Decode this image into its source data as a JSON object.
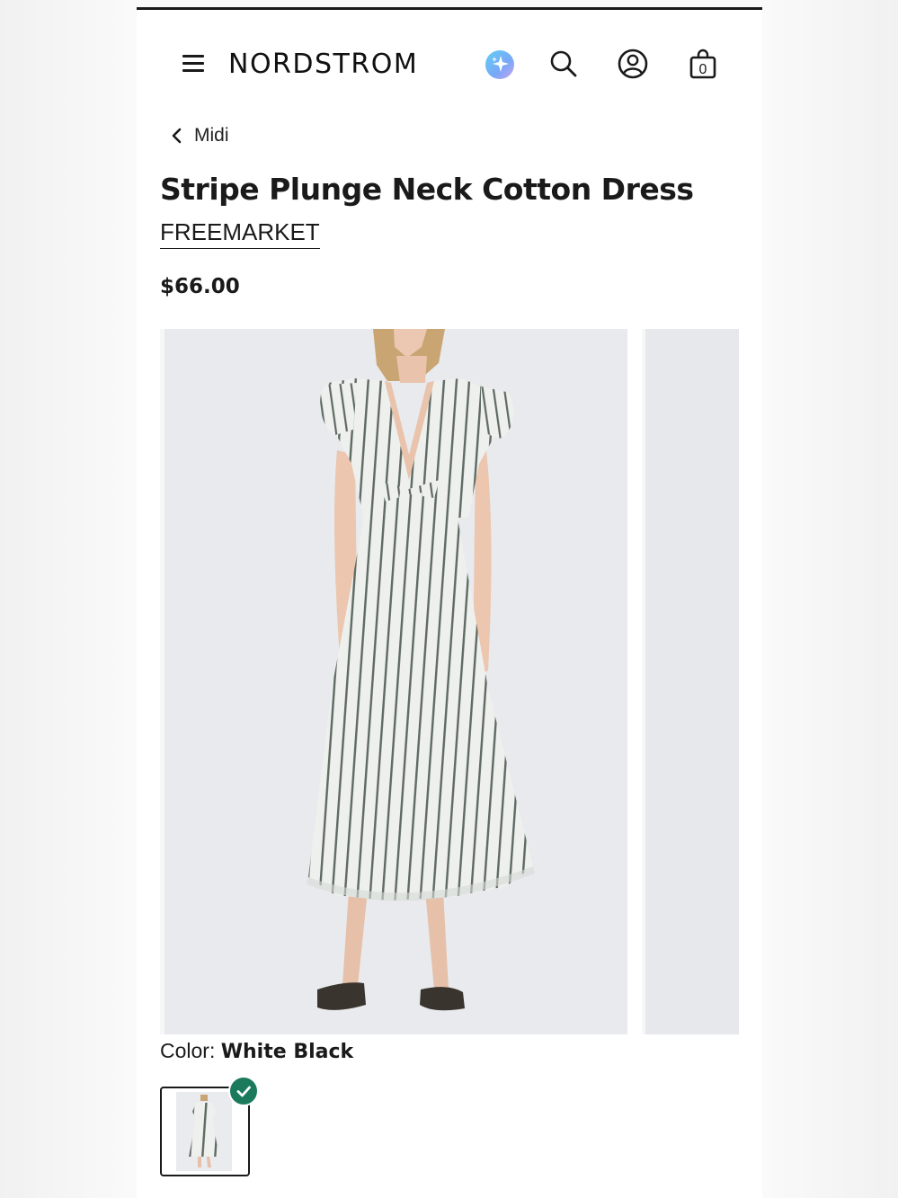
{
  "header": {
    "logo": "NORDSTROM",
    "icons": [
      "menu-icon",
      "ai-sparkle-icon",
      "search-icon",
      "account-icon",
      "shopping-bag-icon"
    ],
    "bag_count": "0"
  },
  "breadcrumb": {
    "label": "Midi"
  },
  "product": {
    "title": "Stripe Plunge Neck Cotton Dress",
    "brand": "FREEMARKET",
    "price": "$66.00"
  },
  "color": {
    "label": "Color:",
    "selected": "White Black",
    "selected_swatch_checked": true
  },
  "colors": {
    "accent_check": "#1b7a5b",
    "text": "#1a1a1a"
  }
}
